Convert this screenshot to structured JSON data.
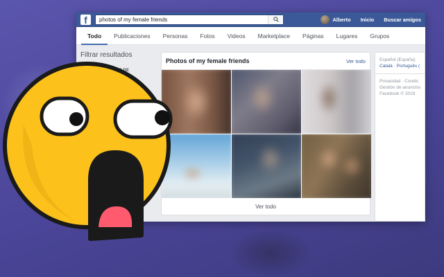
{
  "topbar": {
    "logo": "f",
    "search_value": "photos of my female friends",
    "user_name": "Alberto",
    "links": [
      "Inicio",
      "Buscar amigos"
    ]
  },
  "tabs": [
    "Todo",
    "Publicaciones",
    "Personas",
    "Fotos",
    "Videos",
    "Marketplace",
    "Páginas",
    "Lugares",
    "Grupos"
  ],
  "left": {
    "title": "Filtrar resultados",
    "partial_label": "S DE"
  },
  "results": {
    "title": "Photos of my female friends",
    "see_all_top": "Ver todo",
    "see_all_bottom": "Ver todo",
    "photo_count": 6
  },
  "right": {
    "lang_line1": "Español (España)",
    "lang_line2": "Català · Português (",
    "foot_line1": "Privacidad · Condic",
    "foot_line2": "Gestión de anuncios",
    "foot_line3": "Facebook © 2019"
  },
  "colors": {
    "brand": "#3b5998",
    "background": "#4f4a9f",
    "emoji_yellow": "#fcc21b",
    "emoji_mouth": "#ff5a6e"
  },
  "icons": {
    "search": "search-icon",
    "emoji": "shocked-face-emoji"
  }
}
